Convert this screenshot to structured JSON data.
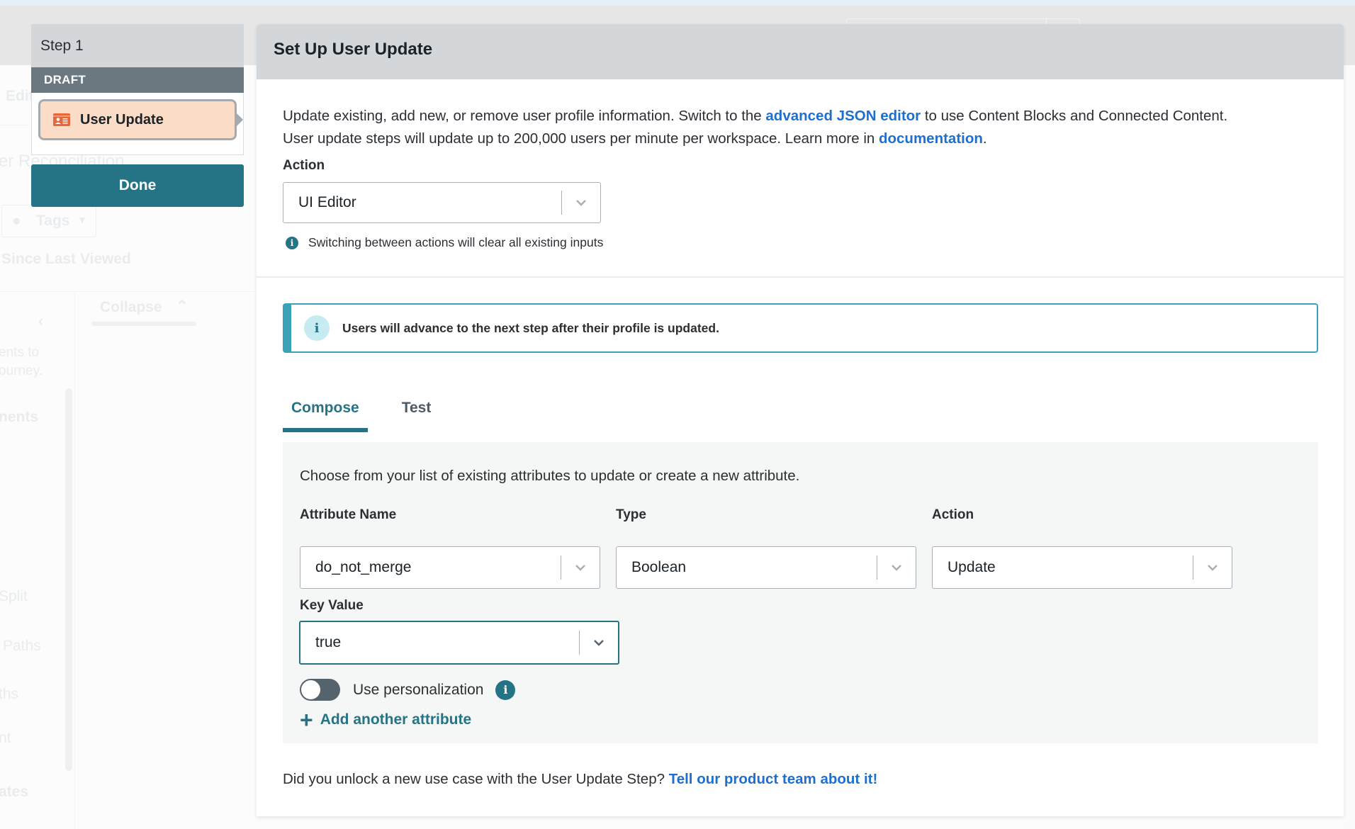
{
  "background": {
    "faded_labels": [
      "Edit",
      "er Reconciliation",
      "Tags",
      "Since Last Viewed",
      "Collapse",
      "ents to",
      "ourney.",
      "nents",
      "Split",
      "Paths",
      "ths",
      "nt",
      "ates"
    ]
  },
  "step": {
    "title": "Step 1",
    "status": "DRAFT",
    "card_label": "User Update",
    "card_icon": "id-card-icon",
    "done_label": "Done"
  },
  "panel": {
    "title": "Set Up User Update",
    "intro_1": "Update existing, add new, or remove user profile information. Switch to the ",
    "intro_link_1": "advanced JSON editor",
    "intro_2": " to use Content Blocks and Connected Content.",
    "intro_3": "User update steps will update up to 200,000 users per minute per workspace. Learn more in ",
    "intro_link_2": "documentation",
    "intro_4": ".",
    "action_label": "Action",
    "action_value": "UI Editor",
    "action_hint": "Switching between actions will clear all existing inputs",
    "callout": "Users will advance to the next step after their profile is updated.",
    "tabs": [
      {
        "label": "Compose",
        "active": true
      },
      {
        "label": "Test",
        "active": false
      }
    ],
    "compose": {
      "description": "Choose from your list of existing attributes to update or create a new attribute.",
      "attribute_name_label": "Attribute Name",
      "attribute_name_value": "do_not_merge",
      "type_label": "Type",
      "type_value": "Boolean",
      "action_label": "Action",
      "action_value": "Update",
      "key_value_label": "Key Value",
      "key_value_value": "true",
      "personalization_label": "Use personalization",
      "personalization_enabled": false,
      "add_attribute_label": "Add another attribute"
    },
    "footer_text": "Did you unlock a new use case with the User Update Step? ",
    "footer_link": "Tell our product team about it!"
  },
  "colors": {
    "primary": "#257486",
    "link": "#1f6fcf",
    "callout_border": "#3ba3b8",
    "card_bg": "#fbdcc6",
    "card_icon": "#e8673a",
    "draft_bar": "#6b7880"
  }
}
